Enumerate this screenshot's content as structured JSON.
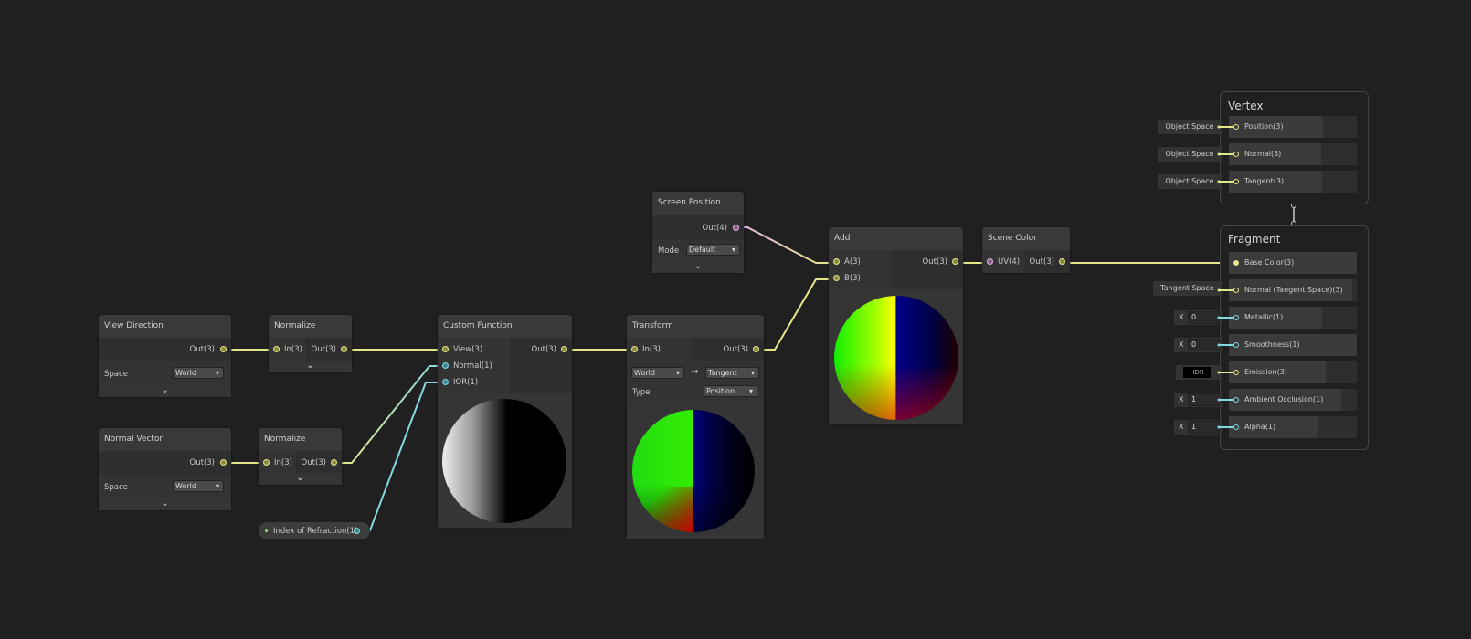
{
  "colors": {
    "background": "#202020",
    "vector3": "#e6e68a",
    "vector1": "#84d8e0",
    "vector4": "#e4b6e4"
  },
  "nodes": {
    "view_direction": {
      "title": "View Direction",
      "out": "Out(3)",
      "space_label": "Space",
      "space_value": "World"
    },
    "normalize1": {
      "title": "Normalize",
      "in": "In(3)",
      "out": "Out(3)"
    },
    "normal_vector": {
      "title": "Normal Vector",
      "out": "Out(3)",
      "space_label": "Space",
      "space_value": "World"
    },
    "normalize2": {
      "title": "Normalize",
      "in": "In(3)",
      "out": "Out(3)"
    },
    "ior": {
      "label": "Index of Refraction(1)"
    },
    "custom_function": {
      "title": "Custom Function",
      "inputs": [
        "View(3)",
        "Normal(1)",
        "IOR(1)"
      ],
      "out": "Out(3)"
    },
    "screen_position": {
      "title": "Screen Position",
      "out": "Out(4)",
      "mode_label": "Mode",
      "mode_value": "Default"
    },
    "transform": {
      "title": "Transform",
      "in": "In(3)",
      "out": "Out(3)",
      "from": "World",
      "arrow": "→",
      "to": "Tangent",
      "type_label": "Type",
      "type_value": "Position"
    },
    "add": {
      "title": "Add",
      "inputs": [
        "A(3)",
        "B(3)"
      ],
      "out": "Out(3)"
    },
    "scene_color": {
      "title": "Scene Color",
      "in": "UV(4)",
      "out": "Out(3)"
    }
  },
  "vertex": {
    "title": "Vertex",
    "rows": [
      {
        "label": "Position(3)",
        "default": "Object Space"
      },
      {
        "label": "Normal(3)",
        "default": "Object Space"
      },
      {
        "label": "Tangent(3)",
        "default": "Object Space"
      }
    ]
  },
  "fragment": {
    "title": "Fragment",
    "rows": [
      {
        "label": "Base Color(3)"
      },
      {
        "label": "Normal (Tangent Space)(3)",
        "default": "Tangent Space"
      },
      {
        "label": "Metallic(1)",
        "x": "X",
        "value": "0"
      },
      {
        "label": "Smoothness(1)",
        "x": "X",
        "value": "0"
      },
      {
        "label": "Emission(3)",
        "default": "HDR"
      },
      {
        "label": "Ambient Occlusion(1)",
        "x": "X",
        "value": "1"
      },
      {
        "label": "Alpha(1)",
        "x": "X",
        "value": "1"
      }
    ]
  }
}
